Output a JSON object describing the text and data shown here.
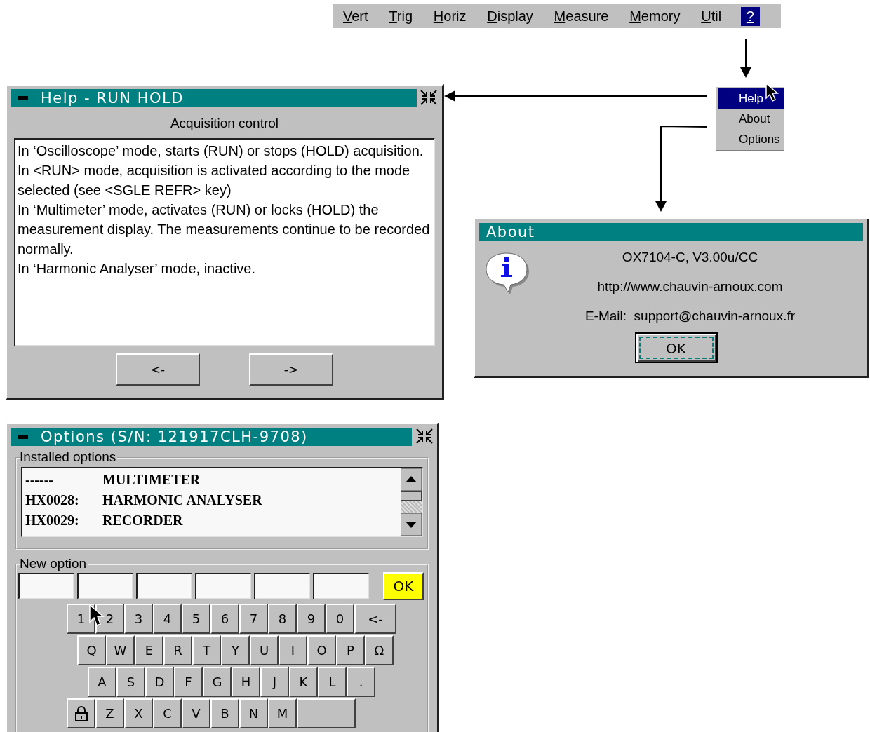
{
  "menu_bar": {
    "items": [
      {
        "label": "Vert",
        "selected": false
      },
      {
        "label": "Trig",
        "selected": false
      },
      {
        "label": "Horiz",
        "selected": false
      },
      {
        "label": "Display",
        "selected": false
      },
      {
        "label": "Measure",
        "selected": false
      },
      {
        "label": "Memory",
        "selected": false
      },
      {
        "label": "Util",
        "selected": false
      },
      {
        "label": "?",
        "selected": true
      }
    ]
  },
  "dropdown": {
    "items": [
      {
        "label": "Help",
        "selected": true
      },
      {
        "label": "About",
        "selected": false
      },
      {
        "label": "Options",
        "selected": false
      }
    ]
  },
  "help_window": {
    "title": "Help - RUN HOLD",
    "heading": "Acquisition control",
    "paragraphs": [
      "In ‘Oscilloscope’ mode, starts (RUN) or stops (HOLD) acquisition.",
      "In <RUN> mode, acquisition is activated according to the mode selected (see <SGLE REFR> key)",
      "In ‘Multimeter’ mode, activates (RUN) or locks (HOLD) the measurement display. The measurements continue to be recorded normally.",
      "In ‘Harmonic Analyser’ mode, inactive."
    ],
    "buttons": [
      "<-",
      "->"
    ]
  },
  "about_window": {
    "title": "About",
    "lines": [
      "OX7104-C, V3.00u/CC",
      "http://www.chauvin-arnoux.com",
      "E-Mail:  support@chauvin-arnoux.fr"
    ],
    "button": "OK"
  },
  "options_window": {
    "title": "Options (S/N: 121917CLH-9708)",
    "installed": {
      "label": "Installed options",
      "rows": [
        {
          "code": "------",
          "name": "MULTIMETER"
        },
        {
          "code": "HX0028:",
          "name": "HARMONIC ANALYSER"
        },
        {
          "code": "HX0029:",
          "name": "RECORDER"
        }
      ]
    },
    "new_option": {
      "label": "New option",
      "ok_button": "OK"
    },
    "keyboard": [
      {
        "keys": [
          "1",
          "2",
          "3",
          "4",
          "5",
          "6",
          "7",
          "8",
          "9",
          "0",
          "<-"
        ]
      },
      {
        "keys": [
          "Q",
          "W",
          "E",
          "R",
          "T",
          "Y",
          "U",
          "I",
          "O",
          "P",
          "Ω"
        ]
      },
      {
        "keys": [
          "A",
          "S",
          "D",
          "F",
          "G",
          "H",
          "J",
          "K",
          "L",
          "."
        ]
      },
      {
        "keys": [
          {
            "kind": "lock"
          },
          {
            "kind": "char",
            "label": "Z"
          },
          {
            "kind": "char",
            "label": "X"
          },
          {
            "kind": "char",
            "label": "C"
          },
          {
            "kind": "char",
            "label": "V"
          },
          {
            "kind": "char",
            "label": "B"
          },
          {
            "kind": "char",
            "label": "N"
          },
          {
            "kind": "char",
            "label": "M"
          },
          {
            "kind": "space"
          }
        ]
      }
    ]
  }
}
